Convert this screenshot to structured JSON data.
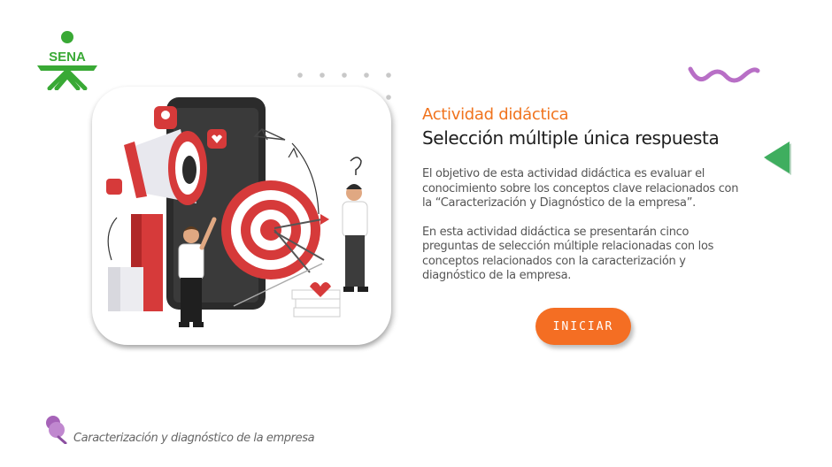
{
  "brand": {
    "logo_text": "SENA",
    "green": "#39a935"
  },
  "accent": {
    "orange": "#f0731d",
    "purple": "#b86fc6",
    "green_arrow": "#3fae5f"
  },
  "activity": {
    "eyebrow": "Actividad didáctica",
    "title": "Selección múltiple única respuesta",
    "paragraph1": "El objetivo de esta actividad didáctica es evaluar el conocimiento sobre los conceptos clave relacionados con la “Caracterización y  Diagnóstico de la empresa”.",
    "paragraph2": "En esta actividad didáctica se presentarán cinco preguntas de selección múltiple relacionadas con los conceptos relacionados con la caracterización y diagnóstico de la empresa."
  },
  "actions": {
    "start_label": "INICIAR"
  },
  "icons": {
    "back": "triangle-left-icon",
    "footer": "pushpin-icon",
    "decor": "wave-icon"
  },
  "footer": {
    "text": "Caracterización y diagnóstico de la empresa"
  }
}
